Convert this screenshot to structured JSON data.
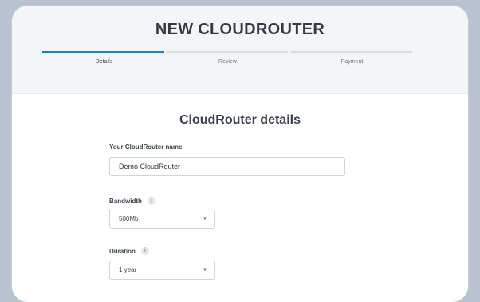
{
  "header": {
    "title": "NEW CLOUDROUTER",
    "steps": [
      {
        "label": "Details",
        "active": true
      },
      {
        "label": "Review",
        "active": false
      },
      {
        "label": "Payment",
        "active": false
      }
    ]
  },
  "form": {
    "section_title": "CloudRouter details",
    "name": {
      "label": "Your CloudRouter name",
      "value": "Demo CloudRouter"
    },
    "bandwidth": {
      "label": "Bandwidth",
      "value": "500Mb",
      "info_icon": "info-icon"
    },
    "duration": {
      "label": "Duration",
      "value": "1 year",
      "info_icon": "info-icon"
    }
  },
  "colors": {
    "accent": "#1e7fcb",
    "background": "#b9c2d0"
  }
}
